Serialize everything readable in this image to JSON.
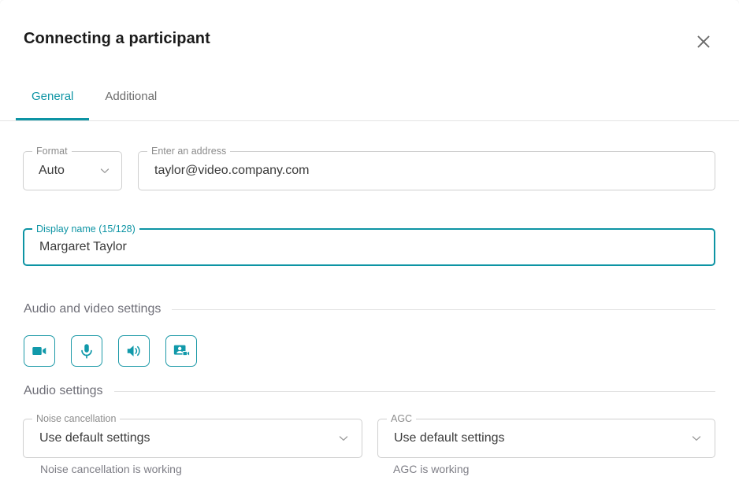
{
  "dialog": {
    "title": "Connecting a participant",
    "close_icon": "close-icon"
  },
  "tabs": [
    {
      "label": "General",
      "active": true
    },
    {
      "label": "Additional",
      "active": false
    }
  ],
  "form": {
    "format": {
      "label": "Format",
      "value": "Auto",
      "options": [
        "Auto"
      ],
      "icon": "chevron-down-icon"
    },
    "address": {
      "label": "Enter an address",
      "value": "taylor@video.company.com",
      "placeholder": "Enter an address"
    },
    "display_name": {
      "label": "Display name (15/128)",
      "value": "Margaret Taylor",
      "placeholder": "Display name",
      "focused": true,
      "char_count": 15,
      "char_max": 128
    }
  },
  "sections": {
    "audio_video": "Audio and video settings",
    "audio": "Audio settings"
  },
  "media_buttons": [
    {
      "name": "video-camera-icon",
      "title": "Camera"
    },
    {
      "name": "microphone-icon",
      "title": "Microphone"
    },
    {
      "name": "speaker-icon",
      "title": "Speaker"
    },
    {
      "name": "presentation-icon",
      "title": "Presentation"
    }
  ],
  "audio_settings": {
    "noise_cancellation": {
      "label": "Noise cancellation",
      "value": "Use default settings",
      "options": [
        "Use default settings"
      ],
      "helper": "Noise cancellation is working"
    },
    "agc": {
      "label": "AGC",
      "value": "Use default settings",
      "options": [
        "Use default settings"
      ],
      "helper": "AGC is working"
    }
  },
  "colors": {
    "accent": "#0d94a4",
    "icon_border": "#1e9aa8",
    "title": "#1b1b1b",
    "label": "#8c8c8c",
    "value": "#3b3b3b",
    "helper": "#7e7e86",
    "section": "#6f6f78",
    "border": "#cfcfcf"
  }
}
